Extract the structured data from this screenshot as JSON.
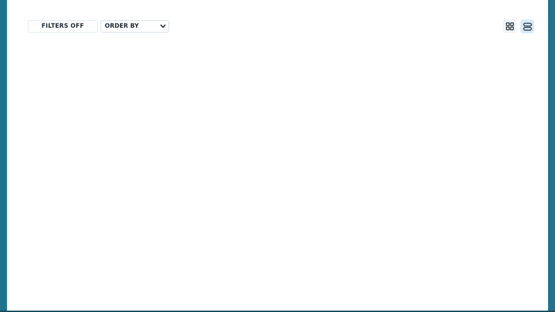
{
  "toolbar": {
    "filters_label": "FILTERS OFF",
    "order_label": "ORDER BY",
    "view_modes": [
      {
        "icon": "grid-view-icon",
        "active": false
      },
      {
        "icon": "list-view-icon",
        "active": true
      }
    ]
  },
  "colors": {
    "background": "#1e7391",
    "panel": "#ffffff",
    "active_view": "#d8ebf7",
    "text": "#1f2630"
  }
}
